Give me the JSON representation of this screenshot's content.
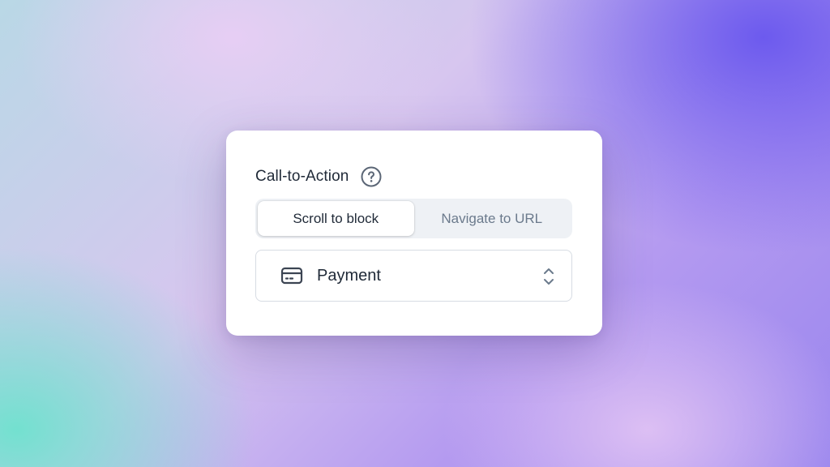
{
  "panel": {
    "title": "Call-to-Action",
    "help_icon": "question-circle-icon"
  },
  "cta_mode": {
    "options": [
      {
        "label": "Scroll to block",
        "selected": true
      },
      {
        "label": "Navigate to URL",
        "selected": false
      }
    ]
  },
  "target_select": {
    "icon": "credit-card-icon",
    "value": "Payment",
    "indicator_icon": "chevron-up-down-icon"
  },
  "colors": {
    "text_primary": "#1f2937",
    "text_muted": "#6b7a8c",
    "segment_track": "#eef1f5",
    "border": "#d7dce3",
    "icon": "#4b5563"
  }
}
